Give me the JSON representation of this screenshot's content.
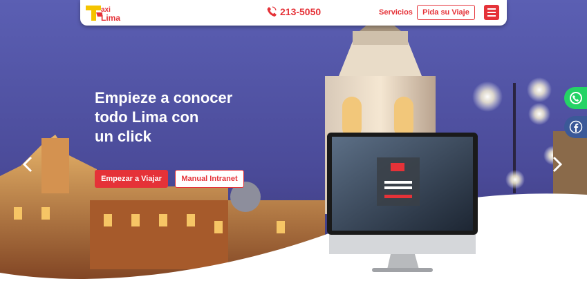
{
  "navbar": {
    "logo_text": "Taxi Lima",
    "phone": "213-5050",
    "services_label": "Servicios",
    "request_trip_label": "Pida su Viaje"
  },
  "hero": {
    "title_lines": [
      "Empieze a conocer",
      "todo Lima con",
      "un click"
    ],
    "primary_button": "Empezar a Viajar",
    "secondary_button": "Manual Intranet"
  },
  "colors": {
    "accent": "#e53238",
    "whatsapp": "#25d366",
    "facebook": "#3b5998"
  },
  "icons": [
    "phone-icon",
    "menu-icon",
    "chevron-left-icon",
    "chevron-right-icon",
    "whatsapp-icon",
    "facebook-icon"
  ]
}
